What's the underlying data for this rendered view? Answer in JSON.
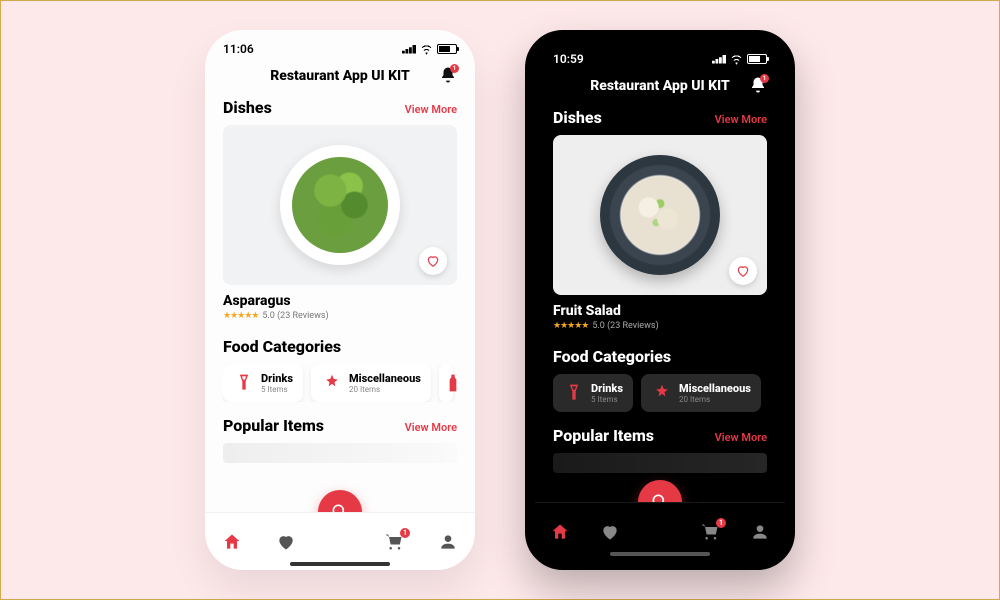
{
  "light": {
    "time": "11:06",
    "app_title": "Restaurant App UI KIT",
    "notification_count": "1",
    "dishes": {
      "title": "Dishes",
      "view_more": "View More",
      "name": "Asparagus",
      "rating": "5.0 (23 Reviews)"
    },
    "categories": {
      "title": "Food Categories",
      "items": [
        {
          "name": "Drinks",
          "count": "5 Items"
        },
        {
          "name": "Miscellaneous",
          "count": "20 Items"
        }
      ]
    },
    "popular": {
      "title": "Popular Items",
      "view_more": "View More"
    },
    "cart_badge": "1"
  },
  "dark": {
    "time": "10:59",
    "app_title": "Restaurant App UI KIT",
    "notification_count": "1",
    "dishes": {
      "title": "Dishes",
      "view_more": "View More",
      "name": "Fruit Salad",
      "rating": "5.0 (23 Reviews)"
    },
    "categories": {
      "title": "Food Categories",
      "items": [
        {
          "name": "Drinks",
          "count": "5 Items"
        },
        {
          "name": "Miscellaneous",
          "count": "20 Items"
        }
      ]
    },
    "popular": {
      "title": "Popular Items",
      "view_more": "View More"
    },
    "cart_badge": "1"
  },
  "stars": "★★★★★",
  "colors": {
    "accent": "#e63946"
  }
}
